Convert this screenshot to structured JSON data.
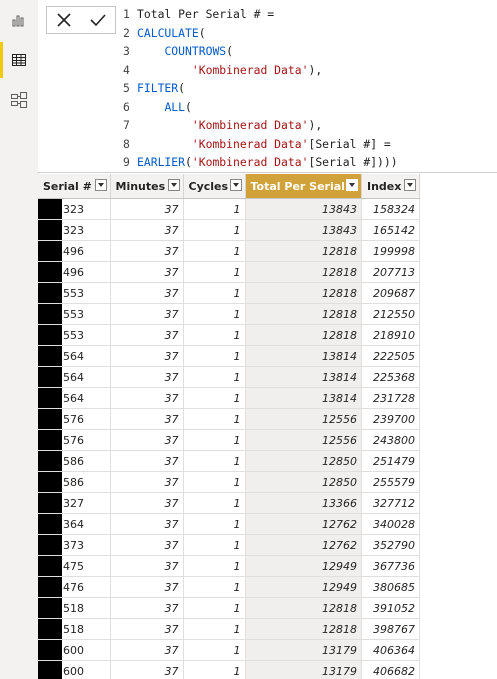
{
  "formula_bar": {
    "lines": [
      {
        "n": "1",
        "code": "Total Per Serial # ="
      },
      {
        "n": "2",
        "code": "CALCULATE("
      },
      {
        "n": "3",
        "code": "    COUNTROWS("
      },
      {
        "n": "4",
        "code": "        'Kombinerad Data'),"
      },
      {
        "n": "5",
        "code": "FILTER("
      },
      {
        "n": "6",
        "code": "    ALL("
      },
      {
        "n": "7",
        "code": "        'Kombinerad Data'),"
      },
      {
        "n": "8",
        "code": "        'Kombinerad Data'[Serial #] ="
      },
      {
        "n": "9",
        "code": "EARLIER('Kombinerad Data'[Serial #])))"
      }
    ]
  },
  "table": {
    "columns": [
      "Serial #",
      "Minutes",
      "Cycles",
      "Total Per Serial #",
      "Index"
    ],
    "highlight_column": "Total Per Serial #",
    "rows": [
      [
        "323",
        "37",
        "1",
        "13843",
        "158324"
      ],
      [
        "323",
        "37",
        "1",
        "13843",
        "165142"
      ],
      [
        "496",
        "37",
        "1",
        "12818",
        "199998"
      ],
      [
        "496",
        "37",
        "1",
        "12818",
        "207713"
      ],
      [
        "553",
        "37",
        "1",
        "12818",
        "209687"
      ],
      [
        "553",
        "37",
        "1",
        "12818",
        "212550"
      ],
      [
        "553",
        "37",
        "1",
        "12818",
        "218910"
      ],
      [
        "564",
        "37",
        "1",
        "13814",
        "222505"
      ],
      [
        "564",
        "37",
        "1",
        "13814",
        "225368"
      ],
      [
        "564",
        "37",
        "1",
        "13814",
        "231728"
      ],
      [
        "576",
        "37",
        "1",
        "12556",
        "239700"
      ],
      [
        "576",
        "37",
        "1",
        "12556",
        "243800"
      ],
      [
        "586",
        "37",
        "1",
        "12850",
        "251479"
      ],
      [
        "586",
        "37",
        "1",
        "12850",
        "255579"
      ],
      [
        "327",
        "37",
        "1",
        "13366",
        "327712"
      ],
      [
        "364",
        "37",
        "1",
        "12762",
        "340028"
      ],
      [
        "373",
        "37",
        "1",
        "12762",
        "352790"
      ],
      [
        "475",
        "37",
        "1",
        "12949",
        "367736"
      ],
      [
        "476",
        "37",
        "1",
        "12949",
        "380685"
      ],
      [
        "518",
        "37",
        "1",
        "12818",
        "391052"
      ],
      [
        "518",
        "37",
        "1",
        "12818",
        "398767"
      ],
      [
        "600",
        "37",
        "1",
        "13179",
        "406364"
      ],
      [
        "600",
        "37",
        "1",
        "13179",
        "406682"
      ]
    ]
  },
  "icons": {
    "rail": [
      "report-view-icon",
      "data-view-icon",
      "model-view-icon"
    ],
    "formula": [
      "cancel-icon",
      "commit-icon"
    ]
  },
  "colors": {
    "accent": "#f2c811",
    "highlight_header": "#d2a23a",
    "dax_keyword": "#035aca",
    "dax_string": "#a31515"
  }
}
